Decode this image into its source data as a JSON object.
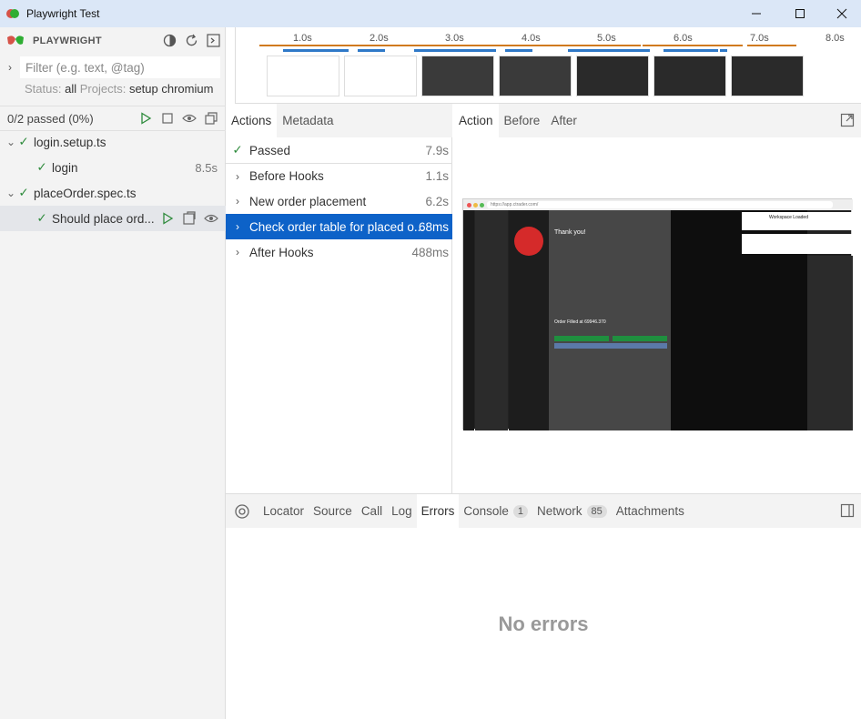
{
  "window": {
    "title": "Playwright Test",
    "minimize": "—",
    "maximize": "☐",
    "close": "✕"
  },
  "sidebar": {
    "brand": "PLAYWRIGHT",
    "filter_placeholder": "Filter (e.g. text, @tag)",
    "status_label": "Status:",
    "status_value": "all",
    "projects_label": "Projects:",
    "projects_value": "setup chromium",
    "passed_summary": "0/2 passed (0%)",
    "tree": [
      {
        "label": "login.setup.ts",
        "duration": ""
      },
      {
        "label": "login",
        "duration": "8.5s"
      },
      {
        "label": "placeOrder.spec.ts",
        "duration": ""
      },
      {
        "label": "Should place ord...",
        "duration": ""
      }
    ]
  },
  "timeline": {
    "ticks": [
      "1.0s",
      "2.0s",
      "3.0s",
      "4.0s",
      "5.0s",
      "6.0s",
      "7.0s",
      "8.0s"
    ]
  },
  "actions_panel": {
    "tabs": [
      "Actions",
      "Metadata"
    ],
    "items": [
      {
        "label": "Passed",
        "duration": "7.9s"
      },
      {
        "label": "Before Hooks",
        "duration": "1.1s"
      },
      {
        "label": "New order placement",
        "duration": "6.2s"
      },
      {
        "label": "Check order table for placed o...",
        "duration": "68ms"
      },
      {
        "label": "After Hooks",
        "duration": "488ms"
      }
    ]
  },
  "snapshot_panel": {
    "tabs": [
      "Action",
      "Before",
      "After"
    ],
    "url": "https://app.ctrader.com/",
    "thank_you": "Thank you!",
    "workspace_loaded": "Workspace Loaded",
    "order_filled": "Order Filled at 69946.370"
  },
  "bottom_panel": {
    "tabs": [
      "Locator",
      "Source",
      "Call",
      "Log",
      "Errors",
      "Console",
      "Network",
      "Attachments"
    ],
    "console_count": "1",
    "network_count": "85",
    "empty_message": "No errors"
  },
  "colors": {
    "accent": "#0d62c8",
    "pass": "#2e8b3c",
    "titlebar": "#dbe7f7"
  }
}
